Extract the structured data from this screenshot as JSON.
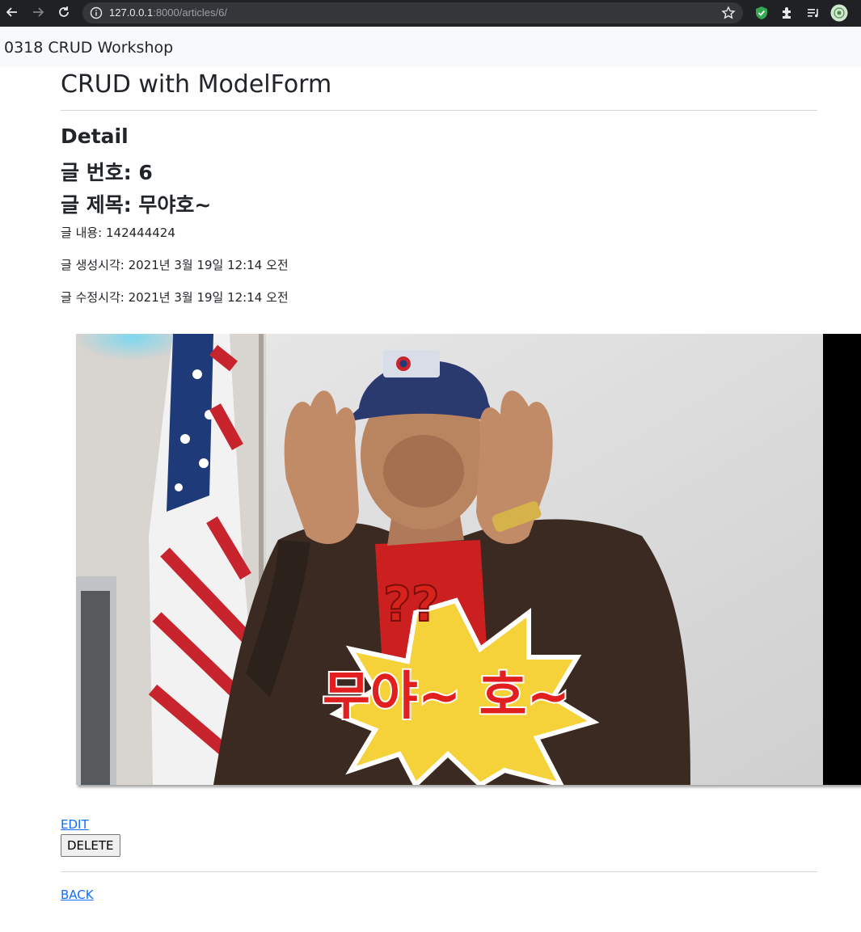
{
  "browser": {
    "url_host": "127.0.0.1",
    "url_rest": ":8000/articles/6/"
  },
  "navbar": {
    "brand": "0318 CRUD Workshop"
  },
  "page": {
    "heading": "CRUD with ModelForm",
    "section": "Detail",
    "article_number": "글 번호: 6",
    "article_title": "글 제목: 무야호~",
    "content": "글 내용: 142444424",
    "created_at": "글 생성시각: 2021년 3월 19일 12:14 오전",
    "updated_at": "글 수정시각: 2021년 3월 19일 12:14 오전",
    "image_caption": "무야~ 호~",
    "image_badge_text": "??",
    "edit_label": "EDIT",
    "delete_label": "DELETE",
    "back_label": "BACK"
  },
  "colors": {
    "link": "#0d6efd",
    "navbar_bg": "#f8f9fa",
    "chrome_bg": "#202124"
  }
}
